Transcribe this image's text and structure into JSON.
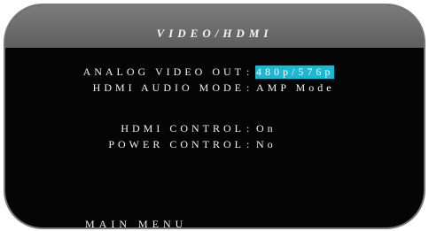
{
  "title": "VIDEO/HDMI",
  "settings": [
    {
      "label": "ANALOG VIDEO OUT",
      "colon": ":",
      "value": "480p/576p"
    },
    {
      "label": "HDMI AUDIO MODE",
      "colon": ":",
      "value": "AMP Mode"
    },
    {
      "label": "HDMI CONTROL",
      "colon": ":",
      "value": "On"
    },
    {
      "label": "POWER CONTROL",
      "colon": ":",
      "value": "No"
    }
  ],
  "footer": {
    "main_menu": "MAIN MENU"
  },
  "colors": {
    "highlight": "#1fb6cf",
    "background": "#050505",
    "header": "#6e6e6e"
  }
}
